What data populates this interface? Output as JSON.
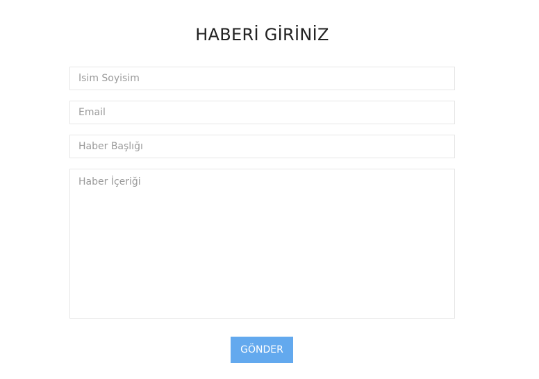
{
  "form": {
    "title": "HABERİ GİRİNİZ",
    "name_placeholder": "İsim Soyisim",
    "email_placeholder": "Email",
    "news_title_placeholder": "Haber Başlığı",
    "news_content_placeholder": "Haber İçeriği",
    "submit_label": "GÖNDER"
  },
  "colors": {
    "button_background": "#63a9ee",
    "field_border": "#e6e6e6",
    "title_text": "#222222"
  }
}
